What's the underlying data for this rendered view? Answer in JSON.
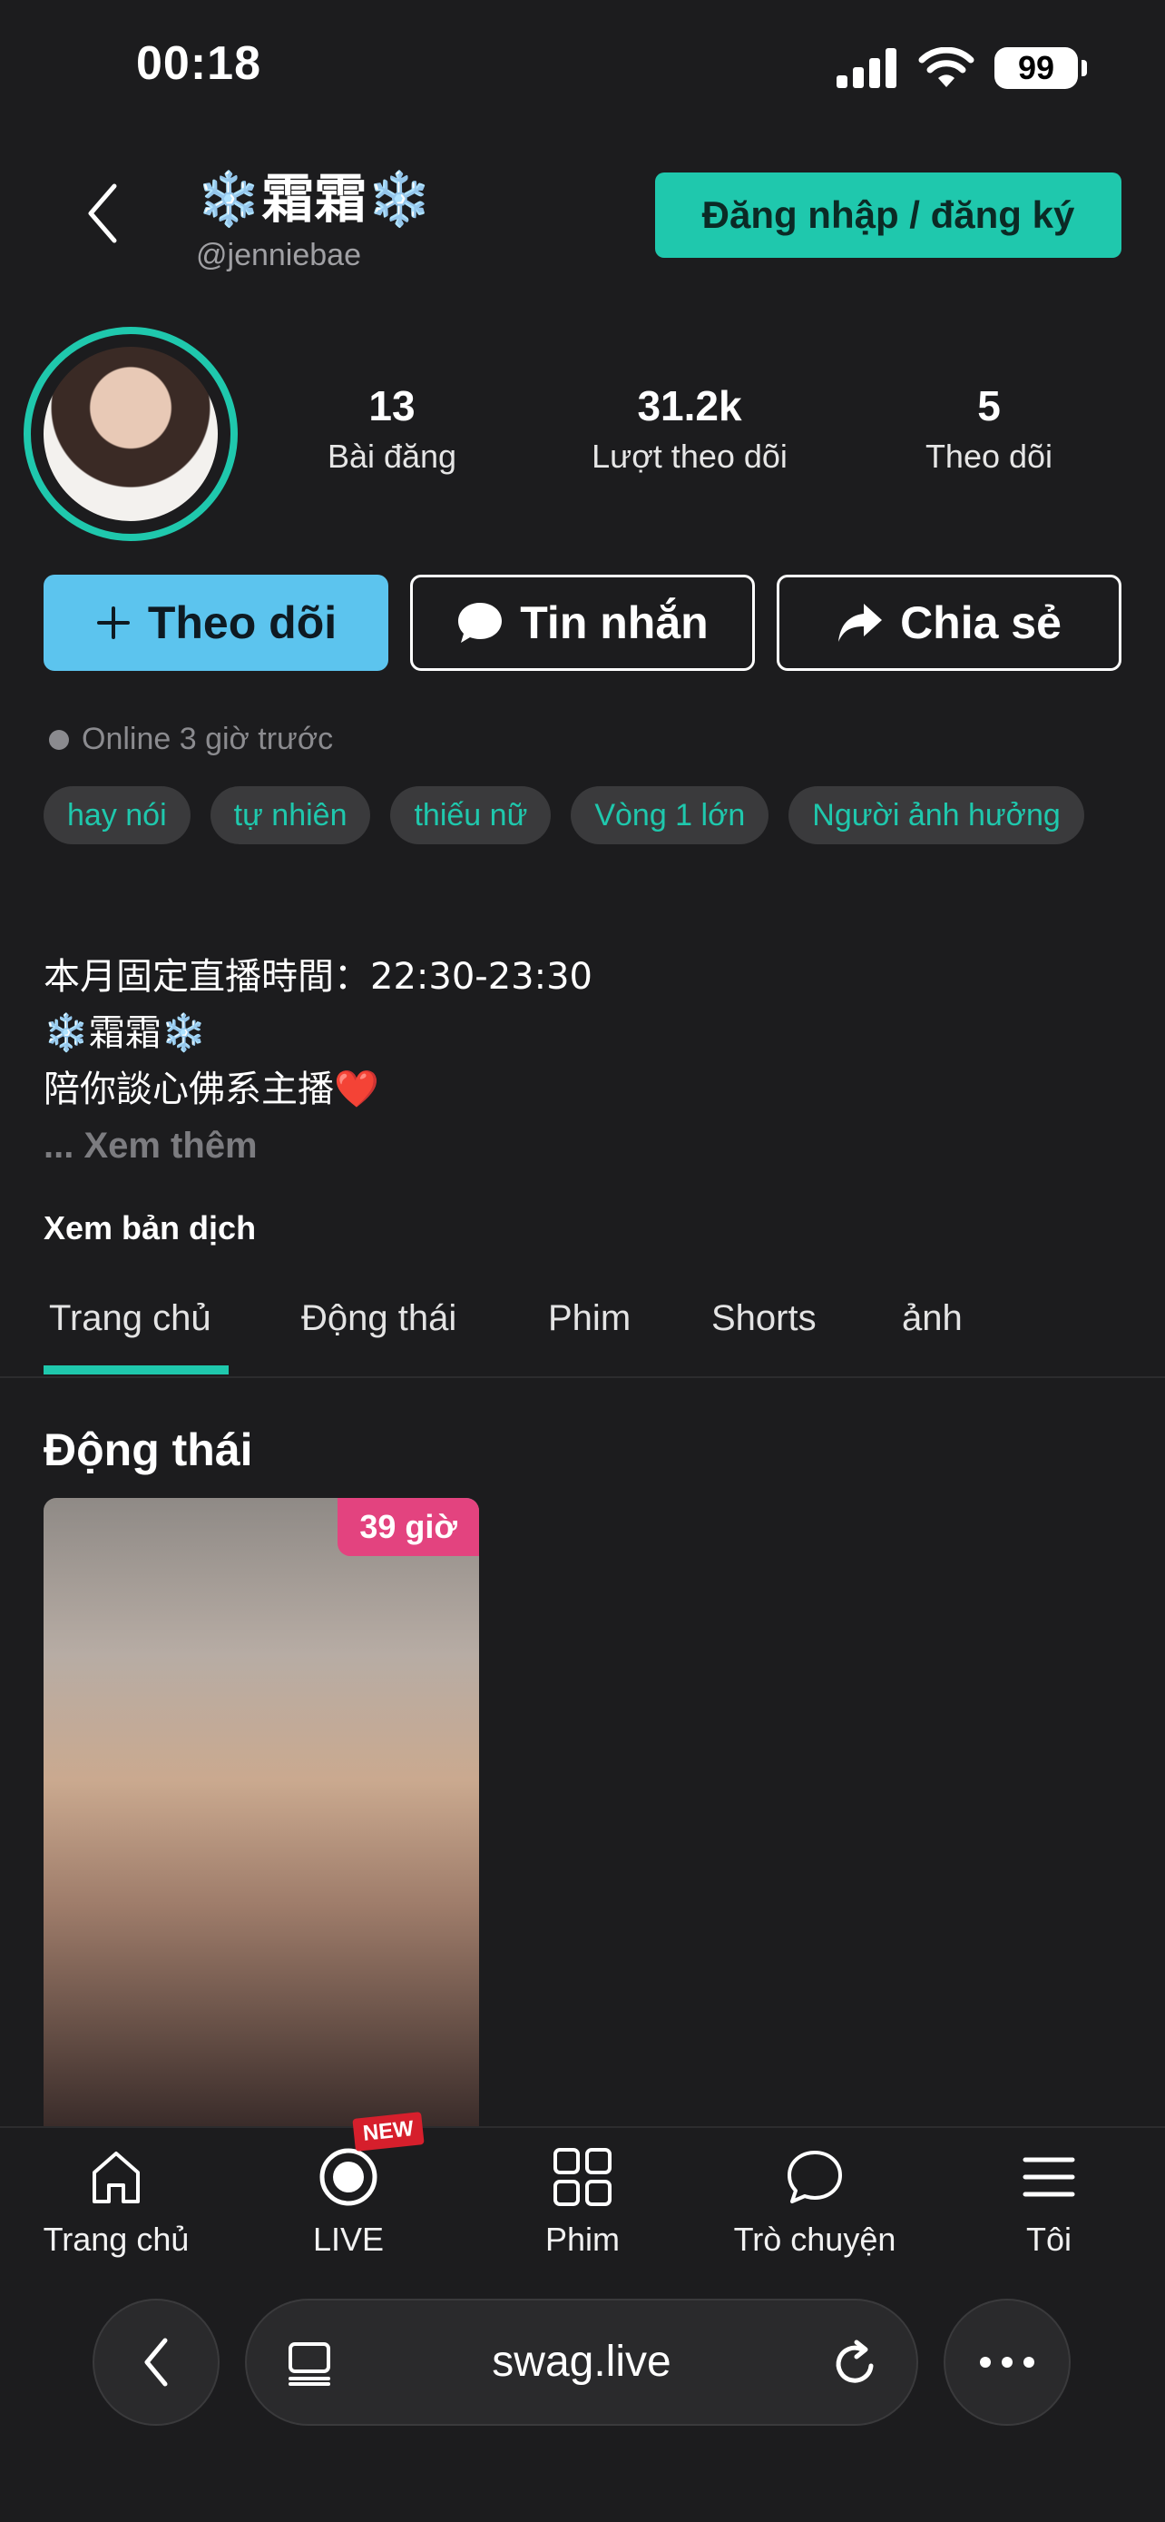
{
  "status_bar": {
    "time": "00:18",
    "battery": "99"
  },
  "header": {
    "display_name": "❄️霜霜❄️",
    "handle": "@jenniebae",
    "login_button": "Đăng nhập / đăng ký"
  },
  "stats": [
    {
      "value": "13",
      "label": "Bài đăng"
    },
    {
      "value": "31.2k",
      "label": "Lượt theo dõi"
    },
    {
      "value": "5",
      "label": "Theo dõi"
    }
  ],
  "actions": {
    "follow": "Theo dõi",
    "message": "Tin nhắn",
    "share": "Chia sẻ"
  },
  "online_status": "Online 3 giờ trước",
  "tags": [
    "hay nói",
    "tự nhiên",
    "thiếu nữ",
    "Vòng 1 lớn",
    "Người ảnh hưởng"
  ],
  "bio": {
    "line1": "本月固定直播時間：22:30-23:30",
    "line2": "❄️霜霜❄️",
    "line3": "陪你談心佛系主播❤️",
    "see_more": "... Xem thêm",
    "translate": "Xem bản dịch"
  },
  "tabs": [
    "Trang chủ",
    "Động thái",
    "Phim",
    "Shorts",
    "ảnh"
  ],
  "section": {
    "title": "Động thái",
    "card_badge": "39 giờ"
  },
  "bottom_nav": {
    "items": [
      "Trang chủ",
      "LIVE",
      "Phim",
      "Trò chuyện",
      "Tôi"
    ],
    "new_badge": "NEW"
  },
  "browser": {
    "url": "swag.live"
  },
  "colors": {
    "accent": "#1fc8ad",
    "follow": "#5cc4ee",
    "badge": "#e3437f",
    "new": "#d61f2c"
  }
}
